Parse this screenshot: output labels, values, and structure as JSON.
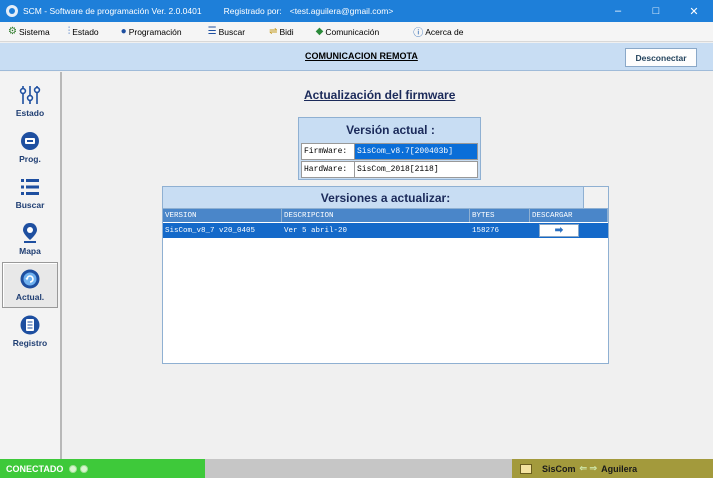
{
  "window": {
    "title": "SCM - Software de programación Ver. 2.0.0401",
    "registered_label": "Registrado por:",
    "email": "<test.aguilera@gmail.com>",
    "minimize": "–",
    "maximize": "□",
    "close": "✕"
  },
  "menu": {
    "items": [
      {
        "label": "Sistema",
        "icon": "sistema-icon"
      },
      {
        "label": "Estado",
        "icon": "estado-icon"
      },
      {
        "label": "Programación",
        "icon": "programacion-icon"
      },
      {
        "label": "Buscar",
        "icon": "buscar-icon"
      },
      {
        "label": "Bidi",
        "icon": "bidi-icon"
      },
      {
        "label": "Comunicación",
        "icon": "comunicacion-icon"
      },
      {
        "label": "Acerca de",
        "icon": "info-icon"
      }
    ]
  },
  "toolbar": {
    "title": "COMUNICACION REMOTA",
    "disconnect_label": "Desconectar"
  },
  "sidebar": {
    "items": [
      {
        "label": "Estado",
        "icon": "sliders-icon",
        "active": false
      },
      {
        "label": "Prog.",
        "icon": "program-icon",
        "active": false
      },
      {
        "label": "Buscar",
        "icon": "list-icon",
        "active": false
      },
      {
        "label": "Mapa",
        "icon": "map-pin-icon",
        "active": false
      },
      {
        "label": "Actual.",
        "icon": "update-icon",
        "active": true
      },
      {
        "label": "Registro",
        "icon": "record-icon",
        "active": false
      }
    ]
  },
  "content": {
    "title": "Actualización del firmware",
    "current_version": {
      "title": "Versión actual :",
      "firmware_label": "FirmWare:",
      "firmware_value": "SisCom_v8.7[200403b]",
      "hardware_label": "HardWare:",
      "hardware_value": "SisCom_2018[2118]"
    },
    "updates": {
      "title": "Versiones a actualizar:",
      "columns": [
        "VERSION",
        "DESCRIPCION",
        "BYTES",
        "DESCARGAR"
      ],
      "rows": [
        {
          "version": "SisCom_v8_7 v20_0405",
          "descripcion": "Ver 5 abril-20",
          "bytes": "158276",
          "descargar": "➡"
        }
      ]
    }
  },
  "status": {
    "connected": "CONECTADO",
    "left_device": "SisCom",
    "arrows": "⇐ ⇒",
    "right_device": "Aguilera"
  },
  "colors": {
    "titlebar": "#1e7fd9",
    "toolbar": "#c8ddf3",
    "selected_row": "#1469c9",
    "connected": "#3ec93a",
    "status_right": "#a39a3c"
  }
}
